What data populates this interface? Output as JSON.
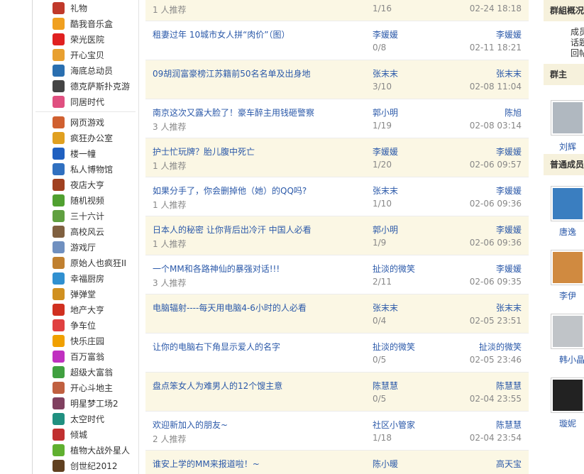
{
  "sidebar": {
    "groups": [
      [
        {
          "label": "礼物",
          "icon": "gift-icon",
          "color": "#c0392b"
        },
        {
          "label": "酷我音乐盒",
          "icon": "music-box-icon",
          "color": "#f0a020"
        },
        {
          "label": "荣光医院",
          "icon": "hospital-cross-icon",
          "color": "#e02020"
        },
        {
          "label": "开心宝贝",
          "icon": "baby-icon",
          "color": "#e8a030"
        },
        {
          "label": "海底总动员",
          "icon": "fish-icon",
          "color": "#2a6fb0"
        },
        {
          "label": "德克萨斯扑克游",
          "icon": "poker-icon",
          "color": "#444444"
        },
        {
          "label": "同居时代",
          "icon": "heart-house-icon",
          "color": "#e05080"
        }
      ],
      [
        {
          "label": "网页游戏",
          "icon": "game-icon",
          "color": "#d06030"
        },
        {
          "label": "疯狂办公室",
          "icon": "office-icon",
          "color": "#e0a020"
        },
        {
          "label": "楼一幢",
          "icon": "building-icon",
          "color": "#2060c0"
        },
        {
          "label": "私人博物馆",
          "icon": "museum-icon",
          "color": "#3070c0"
        },
        {
          "label": "夜店大亨",
          "icon": "microphone-icon",
          "color": "#a04020"
        },
        {
          "label": "随机视频",
          "icon": "video-icon",
          "color": "#50a030"
        },
        {
          "label": "三十六计",
          "icon": "strategy-icon",
          "color": "#60a040"
        },
        {
          "label": "高校风云",
          "icon": "school-icon",
          "color": "#806040"
        },
        {
          "label": "游戏厅",
          "icon": "arcade-icon",
          "color": "#7090c0"
        },
        {
          "label": "原始人也疯狂II",
          "icon": "caveman-icon",
          "color": "#c08030"
        },
        {
          "label": "幸福厨房",
          "icon": "kitchen-icon",
          "color": "#3090d0"
        },
        {
          "label": "弹弹堂",
          "icon": "bomb-icon",
          "color": "#d09020"
        },
        {
          "label": "地产大亨",
          "icon": "property-icon",
          "color": "#d03020"
        },
        {
          "label": "争车位",
          "icon": "parking-icon",
          "color": "#e04040"
        },
        {
          "label": "快乐庄园",
          "icon": "farm-icon",
          "color": "#f0a000"
        },
        {
          "label": "百万富翁",
          "icon": "star-icon",
          "color": "#c030c0"
        },
        {
          "label": "超级大富翁",
          "icon": "rich-man-icon",
          "color": "#40a040"
        },
        {
          "label": "开心斗地主",
          "icon": "cards-icon",
          "color": "#c06040"
        },
        {
          "label": "明星梦工场2",
          "icon": "star-face-icon",
          "color": "#804060"
        },
        {
          "label": "太空时代",
          "icon": "planet-icon",
          "color": "#209080"
        },
        {
          "label": "倾城",
          "icon": "city-icon",
          "color": "#c03030"
        },
        {
          "label": "植物大战外星人",
          "icon": "plant-icon",
          "color": "#60b030"
        },
        {
          "label": "创世纪2012",
          "icon": "genesis-icon",
          "color": "#604020"
        }
      ]
    ]
  },
  "topics": [
    {
      "title": "",
      "sub": "1 人推荐",
      "author": "",
      "count": "1/16",
      "last": "",
      "time": "02-24 18:18"
    },
    {
      "title": "租妻过年  10城市女人拼“肉价”（图）",
      "sub": "",
      "author": "李媛媛",
      "count": "0/8",
      "last": "李媛媛",
      "time": "02-11 18:21"
    },
    {
      "title": "09胡润富豪榜江苏籍前50名名单及出身地",
      "sub": "",
      "author": "张末末",
      "count": "3/10",
      "last": "张末末",
      "time": "02-08 11:04"
    },
    {
      "title": "南京这次又露大脸了！豪车醉主用钱砸警察",
      "sub": "3 人推荐",
      "author": "郭小明",
      "count": "1/19",
      "last": "陈旭",
      "time": "02-08 03:14"
    },
    {
      "title": "护士忙玩牌？胎儿腹中死亡",
      "sub": "1 人推荐",
      "author": "李媛媛",
      "count": "1/20",
      "last": "李媛媛",
      "time": "02-06 09:57"
    },
    {
      "title": "如果分手了，你会删掉他（她）的QQ吗?",
      "sub": "1 人推荐",
      "author": "张末末",
      "count": "1/10",
      "last": "李媛媛",
      "time": "02-06 09:36"
    },
    {
      "title": "日本人的秘密  让你背后出冷汗  中国人必看",
      "sub": "1 人推荐",
      "author": "郭小明",
      "count": "1/9",
      "last": "李媛媛",
      "time": "02-06 09:36"
    },
    {
      "title": "一个MM和各路神仙的暴强对话!!!",
      "sub": "3 人推荐",
      "author": "扯淡的微笑",
      "count": "2/11",
      "last": "李媛媛",
      "time": "02-06 09:35"
    },
    {
      "title": "电脑辐射----每天用电脑4-6小时的人必看",
      "sub": "",
      "author": "张末末",
      "count": "0/4",
      "last": "张末末",
      "time": "02-05 23:51"
    },
    {
      "title": "让你的电脑右下角显示爱人的名字",
      "sub": "",
      "author": "扯淡的微笑",
      "count": "0/5",
      "last": "扯淡的微笑",
      "time": "02-05 23:46"
    },
    {
      "title": "盘点笨女人为难男人的12个馊主意",
      "sub": "",
      "author": "陈慧慧",
      "count": "0/5",
      "last": "陈慧慧",
      "time": "02-04 23:55"
    },
    {
      "title": "欢迎新加入的朋友~",
      "sub": "2 人推荐",
      "author": "社区小管家",
      "count": "1/18",
      "last": "陈慧慧",
      "time": "02-04 23:54"
    },
    {
      "title": "谁安上学的MM来报道啦！~",
      "sub": "",
      "author": "陈小暖",
      "count": "",
      "last": "高天宝",
      "time": ""
    }
  ],
  "right_panel": {
    "overview_title": "群組概况",
    "stats": [
      "成员",
      "话题",
      "回帖"
    ],
    "owner_title": "群主",
    "owner": {
      "name": "刘辉",
      "color": "#b0b8c0"
    },
    "members_title": "普通成员",
    "members": [
      {
        "name": "唐逸",
        "color": "#3a7ec0"
      },
      {
        "name": "李伊",
        "color": "#d08a40"
      },
      {
        "name": "韩小晶",
        "color": "#c0c4c8"
      },
      {
        "name": "璇妮",
        "color": "#222222"
      }
    ]
  }
}
